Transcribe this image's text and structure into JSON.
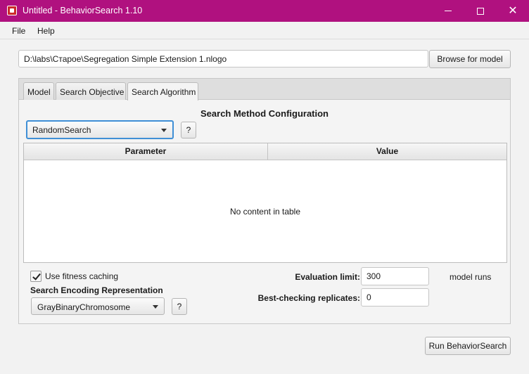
{
  "window": {
    "title": "Untitled - BehaviorSearch 1.10",
    "controls": {
      "minimize": "minimize-icon",
      "maximize": "maximize-icon",
      "close": "close-icon"
    }
  },
  "menu": {
    "file": "File",
    "help": "Help"
  },
  "model": {
    "path": "D:\\labs\\Старое\\Segregation Simple Extension 1.nlogo",
    "browse_label": "Browse for model"
  },
  "tabs": [
    {
      "label": "Model"
    },
    {
      "label": "Search Objective"
    },
    {
      "label": "Search Algorithm",
      "selected": true
    }
  ],
  "search_algorithm": {
    "section_title": "Search Method Configuration",
    "method": "RandomSearch",
    "help_label": "?",
    "table": {
      "columns": [
        "Parameter",
        "Value"
      ],
      "rows": [],
      "empty_message": "No content in table"
    },
    "fitness_caching_label": "Use fitness caching",
    "fitness_caching_checked": true,
    "encoding_title": "Search Encoding Representation",
    "encoding": "GrayBinaryChromosome",
    "encoding_help_label": "?",
    "evaluation_limit_label": "Evaluation limit:",
    "evaluation_limit": "300",
    "evaluation_units": "model runs",
    "best_checking_label": "Best-checking replicates:",
    "best_checking": "0"
  },
  "run_label": "Run BehaviorSearch"
}
